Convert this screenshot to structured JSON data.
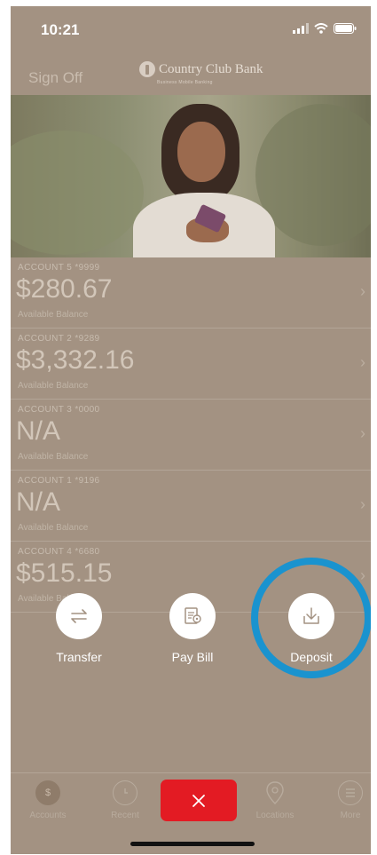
{
  "status_bar": {
    "time": "10:21"
  },
  "header": {
    "sign_off": "Sign Off",
    "brand": "Country Club Bank",
    "brand_sub": "Business Mobile Banking"
  },
  "accounts": [
    {
      "name": "ACCOUNT 5 *9999",
      "amount": "$280.67",
      "sub": "Available Balance"
    },
    {
      "name": "ACCOUNT 2 *9289",
      "amount": "$3,332.16",
      "sub": "Available Balance"
    },
    {
      "name": "ACCOUNT 3 *0000",
      "amount": "N/A",
      "sub": "Available Balance"
    },
    {
      "name": "ACCOUNT 1 *9196",
      "amount": "N/A",
      "sub": "Available Balance"
    },
    {
      "name": "ACCOUNT 4 *6680",
      "amount": "$515.15",
      "sub": "Available Balance"
    }
  ],
  "actions": {
    "transfer": "Transfer",
    "pay_bill": "Pay Bill",
    "deposit": "Deposit"
  },
  "tabs": {
    "accounts": "Accounts",
    "recent": "Recent",
    "locations": "Locations",
    "more": "More"
  },
  "colors": {
    "overlay": "#a39282",
    "highlight": "#1a93cf",
    "close_button": "#e31b23"
  }
}
